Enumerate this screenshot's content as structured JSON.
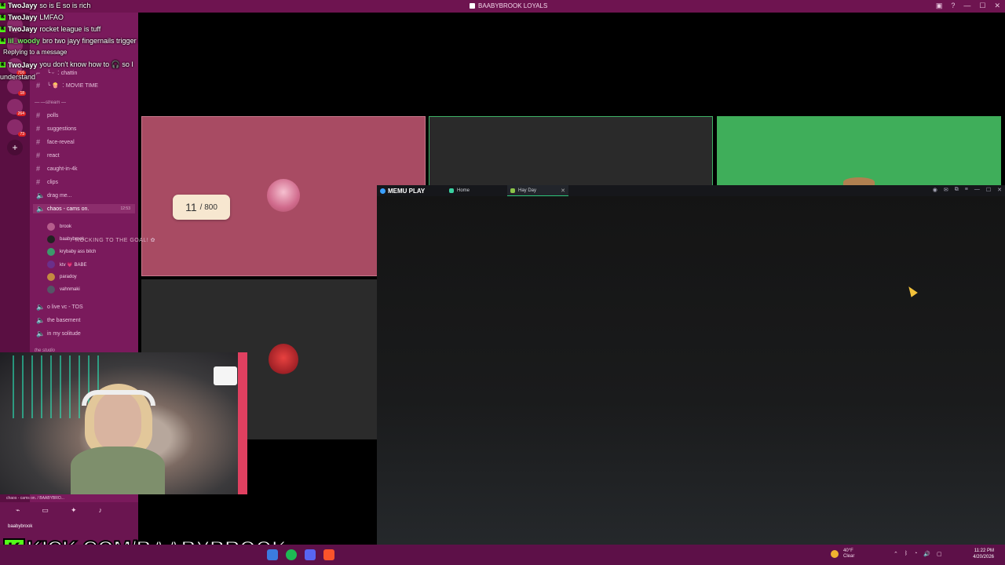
{
  "window_title": "BAABYBROOK LOYALS",
  "chat": [
    {
      "user": "TwoJayy",
      "text": "so is E so is rich",
      "green": false
    },
    {
      "user": "TwoJayy",
      "text": "LMFAO",
      "green": false
    },
    {
      "user": "TwoJayy",
      "text": "rocket league is tuff",
      "green": false
    },
    {
      "user": "lil_woody",
      "text": "bro two jayy fingernails trigger me",
      "green": true
    },
    {
      "user": "",
      "text": "Replying to a message",
      "green": false
    },
    {
      "user": "TwoJayy",
      "text": "you don't know how to 🎧 so I",
      "green": false
    },
    {
      "user": "",
      "text": "understand",
      "green": false
    }
  ],
  "channels": [
    {
      "label": "╰ ᵕ ︰chattin",
      "type": "text"
    },
    {
      "label": "╰ 🍿 ︰MOVIE TIME",
      "type": "text"
    },
    {
      "label": "—·—stream —",
      "type": "category"
    },
    {
      "label": "polls",
      "type": "text"
    },
    {
      "label": "suggestions",
      "type": "text"
    },
    {
      "label": "face-reveal",
      "type": "text"
    },
    {
      "label": "react",
      "type": "text"
    },
    {
      "label": "caught-in-4k",
      "type": "text"
    },
    {
      "label": "clips",
      "type": "text"
    },
    {
      "label": "drag me...",
      "type": "text"
    },
    {
      "label": "chaos - cams on.",
      "type": "voice-active"
    },
    {
      "label": "o live vc - TOS",
      "type": "voice"
    },
    {
      "label": "the basement",
      "type": "voice"
    },
    {
      "label": "in my solitude",
      "type": "voice"
    },
    {
      "label": "the studio",
      "type": "category"
    }
  ],
  "voice_users": [
    "brook",
    "baabybrook",
    "krybaby ass bitch",
    "ktv 💗 BABE",
    "paradoy",
    "vahnmaki"
  ],
  "voice_time": "12:53",
  "goal": {
    "current": "11",
    "total": "800",
    "text": "ROCKING TO THE GOAL! ✿"
  },
  "memu": {
    "logo": "MEMU PLAY",
    "tabs": [
      {
        "label": "Home"
      },
      {
        "label": "Hay Day"
      }
    ]
  },
  "userbar": {
    "name": "baabybrook",
    "status": "chaos - cams on. / BAABYBRO..."
  },
  "banner": {
    "k": "K",
    "text": "KICK.COM/BAABYBROOK"
  },
  "taskbar": {
    "weather_temp": "40°F",
    "weather_desc": "Clear",
    "time": "11:22 PM",
    "date": "4/20/2026"
  },
  "colors": {
    "accent": "#6e1450",
    "kick_green": "#53fc18",
    "tile_pink": "#a84b63",
    "tile_green": "#3fae5a"
  }
}
